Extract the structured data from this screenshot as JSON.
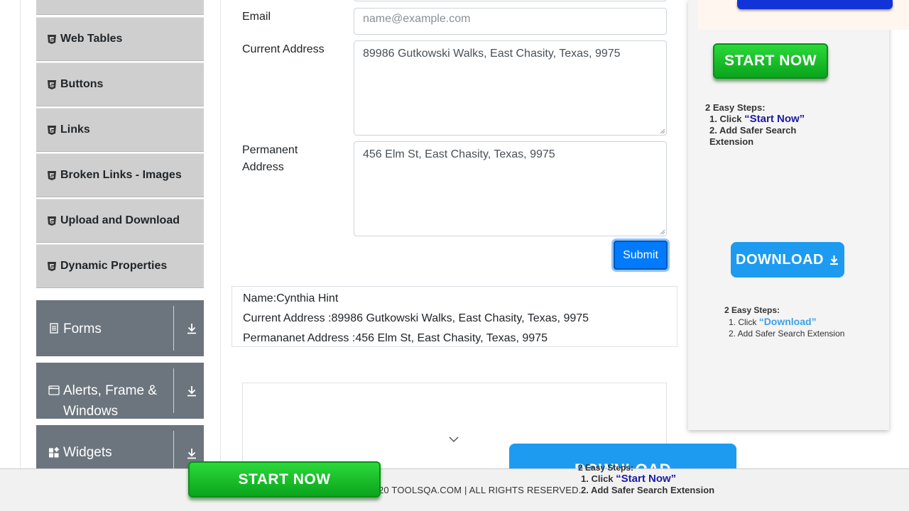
{
  "sidebar": {
    "items": [
      {
        "label": "Web Tables"
      },
      {
        "label": "Buttons"
      },
      {
        "label": "Links"
      },
      {
        "label": "Broken Links - Images"
      },
      {
        "label": "Upload and Download"
      },
      {
        "label": "Dynamic Properties"
      }
    ],
    "groups": [
      {
        "label": "Forms",
        "icon": "document-icon"
      },
      {
        "label": "Alerts, Frame & Windows",
        "icon": "window-icon"
      },
      {
        "label": "Widgets",
        "icon": "widgets-icon"
      }
    ]
  },
  "form": {
    "email_label": "Email",
    "email_placeholder": "name@example.com",
    "current_address_label": "Current Address",
    "current_address_value": "89986 Gutkowski Walks, East Chasity, Texas, 9975",
    "permanent_address_label": "Permanent Address",
    "permanent_address_value": "456 Elm St, East Chasity, Texas, 9975",
    "submit_label": "Submit"
  },
  "output": {
    "name": "Name:Cynthia Hint",
    "current_address": "Current Address :89986 Gutkowski Walks, East Chasity, Texas, 9975",
    "permanent_address": "Permananet Address :456 Elm St, East Chasity, Texas, 9975"
  },
  "ad_right": {
    "start_now": "START NOW",
    "steps_title": "2 Easy Steps:",
    "step1_prefix": "1. Click",
    "step1_highlight": "“Start Now”",
    "step2": "2. Add Safer Search Extension",
    "download": "DOWNLOAD",
    "steps2_title": "2 Easy Steps:",
    "step2_1_prefix": "1. Click",
    "step2_1_highlight": "“Download”",
    "step2_2": "2. Add Safer Search Extension"
  },
  "ad_bottom": {
    "start_now": "START NOW",
    "download": "DOWNLOAD",
    "steps_title": "2 Easy Steps:",
    "step1_prefix": "1. Click",
    "step1_highlight": "“Start Now”",
    "step2": "2. Add Safer Search Extension"
  },
  "footer": {
    "copyright": "20 TOOLSQA.COM | ALL RIGHTS RESERVED."
  },
  "colors": {
    "primary": "#007bff",
    "sidebar_group": "#6c757d",
    "menu_item": "#cfcfcf",
    "ad_green": "#0aa41c",
    "ad_blue": "#1d9bf0"
  }
}
